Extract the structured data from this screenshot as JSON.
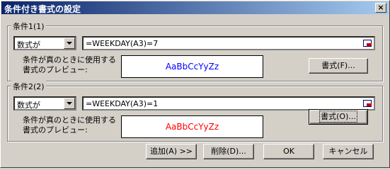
{
  "dialog": {
    "title": "条件付き書式の設定",
    "close_label": "×"
  },
  "conditions": [
    {
      "label": "条件1(1)",
      "type_value": "数式が",
      "formula": "=WEEKDAY(A3)=7",
      "preview_label": "条件が真のときに使用する書式のプレビュー:",
      "preview_text": "AaBbCcYyZz",
      "preview_color": "#0000ff",
      "format_button": "書式(F)..."
    },
    {
      "label": "条件2(2)",
      "type_value": "数式が",
      "formula": "=WEEKDAY(A3)=1",
      "preview_label": "条件が真のときに使用する書式のプレビュー:",
      "preview_text": "AaBbCcYyZz",
      "preview_color": "#ff0000",
      "format_button": "書式(O)..."
    }
  ],
  "buttons": {
    "add": "追加(A) >>",
    "delete": "削除(D)...",
    "ok": "OK",
    "cancel": "キャンセル"
  },
  "icons": {
    "close": "close-icon",
    "dropdown": "chevron-down-icon",
    "range_ref": "range-select-icon"
  }
}
